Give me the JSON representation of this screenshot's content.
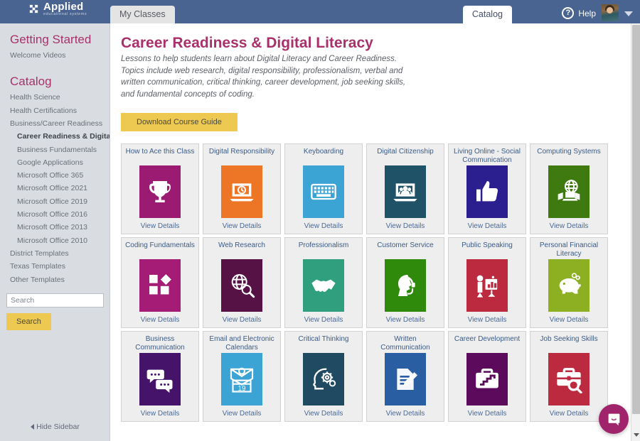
{
  "topbar": {
    "logo_name": "Applied",
    "logo_sub": "educational systems",
    "logo_icon": "pinwheel-logo-icon",
    "tabs": [
      {
        "label": "My Classes",
        "active": false
      },
      {
        "label": "Catalog",
        "active": true
      }
    ],
    "help_label": "Help",
    "help_icon": "question-mark-icon",
    "avatar_alt": "user-avatar",
    "caret_icon": "chevron-down-icon",
    "bar_color": "#4a6491"
  },
  "sidebar": {
    "heading_getting_started": "Getting Started",
    "welcome_videos": "Welcome Videos",
    "heading_catalog": "Catalog",
    "links": [
      {
        "label": "Health Science",
        "indent": false,
        "active": false
      },
      {
        "label": "Health Certifications",
        "indent": false,
        "active": false
      },
      {
        "label": "Business/Career Readiness",
        "indent": false,
        "active": false
      },
      {
        "label": "Career Readiness & Digital Lit...",
        "indent": true,
        "active": true
      },
      {
        "label": "Business Fundamentals",
        "indent": true,
        "active": false
      },
      {
        "label": "Google Applications",
        "indent": true,
        "active": false
      },
      {
        "label": "Microsoft Office 365",
        "indent": true,
        "active": false
      },
      {
        "label": "Microsoft Office 2021",
        "indent": true,
        "active": false
      },
      {
        "label": "Microsoft Office 2019",
        "indent": true,
        "active": false
      },
      {
        "label": "Microsoft Office 2016",
        "indent": true,
        "active": false
      },
      {
        "label": "Microsoft Office 2013",
        "indent": true,
        "active": false
      },
      {
        "label": "Microsoft Office 2010",
        "indent": true,
        "active": false
      },
      {
        "label": "District Templates",
        "indent": false,
        "active": false
      },
      {
        "label": "Texas Templates",
        "indent": false,
        "active": false
      },
      {
        "label": "Other Templates",
        "indent": false,
        "active": false
      }
    ],
    "search_placeholder": "Search",
    "search_value": "",
    "search_button": "Search",
    "hide_sidebar": "Hide Sidebar",
    "heading_color": "#a8316b",
    "background": "#d9dde2"
  },
  "main": {
    "title": "Career Readiness & Digital Literacy",
    "description": "Lessons to help students learn about Digital Literacy and Career Readiness. Topics include web research, digital responsibility, professionalism, verbal and written communication, critical thinking, career development, job seeking skills, and fundamental concepts of coding.",
    "download_button": "Download Course Guide",
    "view_details_label": "View Details",
    "accent_color": "#edc951",
    "courses": [
      {
        "title": "How to Ace this Class",
        "icon": "trophy-icon",
        "color": "#9c1b72",
        "link": "View Details"
      },
      {
        "title": "Digital Responsibility",
        "icon": "laptop-clock-icon",
        "color": "#ec7625",
        "link": "View Details"
      },
      {
        "title": "Keyboarding",
        "icon": "keyboard-icon",
        "color": "#3ba4d4",
        "link": "View Details"
      },
      {
        "title": "Digital Citizenship",
        "icon": "laptop-people-icon",
        "color": "#1f5266",
        "link": "View Details"
      },
      {
        "title": "Living Online - Social Communication",
        "icon": "thumbs-up-icon",
        "color": "#2b1f8f",
        "link": "View Details"
      },
      {
        "title": "Computing Systems",
        "icon": "globe-laptops-icon",
        "color": "#3e7a10",
        "link": "View Details"
      },
      {
        "title": "Coding Fundamentals",
        "icon": "code-blocks-icon",
        "color": "#a51c76",
        "link": "View Details"
      },
      {
        "title": "Web Research",
        "icon": "globe-magnifier-icon",
        "color": "#561245",
        "link": "View Details"
      },
      {
        "title": "Professionalism",
        "icon": "handshake-icon",
        "color": "#2f9f7d",
        "link": "View Details"
      },
      {
        "title": "Customer Service",
        "icon": "headset-person-icon",
        "color": "#2f8a0c",
        "link": "View Details"
      },
      {
        "title": "Public Speaking",
        "icon": "presenter-chart-icon",
        "color": "#bb2a3f",
        "link": "View Details"
      },
      {
        "title": "Personal Financial Literacy",
        "icon": "piggy-bank-icon",
        "color": "#8cb022",
        "link": "View Details"
      },
      {
        "title": "Business Communication",
        "icon": "speech-bubbles-icon",
        "color": "#46136b",
        "link": "View Details"
      },
      {
        "title": "Email and Electronic Calendars",
        "icon": "envelope-calendar-icon",
        "color": "#3ba4d4",
        "link": "View Details"
      },
      {
        "title": "Critical Thinking",
        "icon": "head-gears-icon",
        "color": "#1f4a61",
        "link": "View Details"
      },
      {
        "title": "Written Communication",
        "icon": "document-pencil-icon",
        "color": "#2a5ea2",
        "link": "View Details"
      },
      {
        "title": "Career Development",
        "icon": "briefcase-stairs-icon",
        "color": "#5c0a5c",
        "link": "View Details"
      },
      {
        "title": "Job Seeking Skills",
        "icon": "briefcase-magnifier-icon",
        "color": "#bb2a3f",
        "link": "View Details"
      }
    ]
  },
  "chat": {
    "icon": "chat-bubble-icon",
    "color": "#a0246b"
  }
}
